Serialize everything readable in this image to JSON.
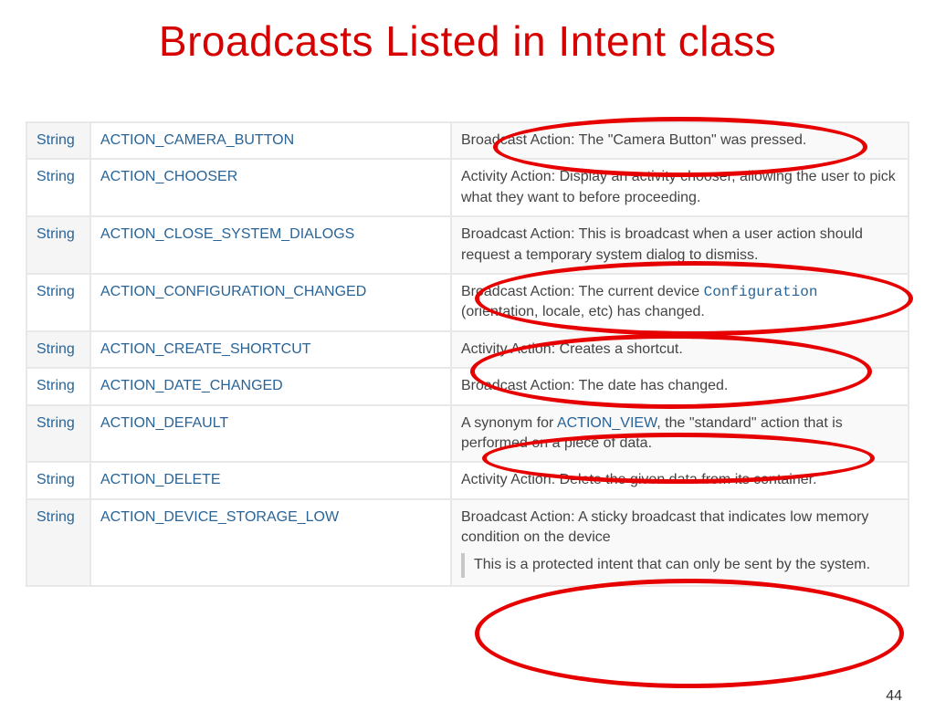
{
  "title": "Broadcasts Listed in Intent class",
  "pagenum": "44",
  "typeLabel": "String",
  "rows": [
    {
      "const": "ACTION_CAMERA_BUTTON",
      "desc": "Broadcast Action: The \"Camera Button\" was pressed."
    },
    {
      "const": "ACTION_CHOOSER",
      "desc": "Activity Action: Display an activity chooser, allowing the user to pick what they want to before proceeding."
    },
    {
      "const": "ACTION_CLOSE_SYSTEM_DIALOGS",
      "desc": "Broadcast Action: This is broadcast when a user action should request a temporary system dialog to dismiss."
    },
    {
      "const": "ACTION_CONFIGURATION_CHANGED",
      "desc_pre": "Broadcast Action: The current device ",
      "desc_link": "Configuration",
      "desc_post": " (orientation, locale, etc) has changed."
    },
    {
      "const": "ACTION_CREATE_SHORTCUT",
      "desc": "Activity Action: Creates a shortcut."
    },
    {
      "const": "ACTION_DATE_CHANGED",
      "desc": "Broadcast Action: The date has changed."
    },
    {
      "const": "ACTION_DEFAULT",
      "desc_pre": "A synonym for ",
      "desc_link": "ACTION_VIEW",
      "desc_post": ", the \"standard\" action that is performed on a piece of data."
    },
    {
      "const": "ACTION_DELETE",
      "desc": "Activity Action: Delete the given data from its container."
    },
    {
      "const": "ACTION_DEVICE_STORAGE_LOW",
      "desc": "Broadcast Action: A sticky broadcast that indicates low memory condition on the device",
      "note": "This is a protected intent that can only be sent by the system."
    }
  ]
}
